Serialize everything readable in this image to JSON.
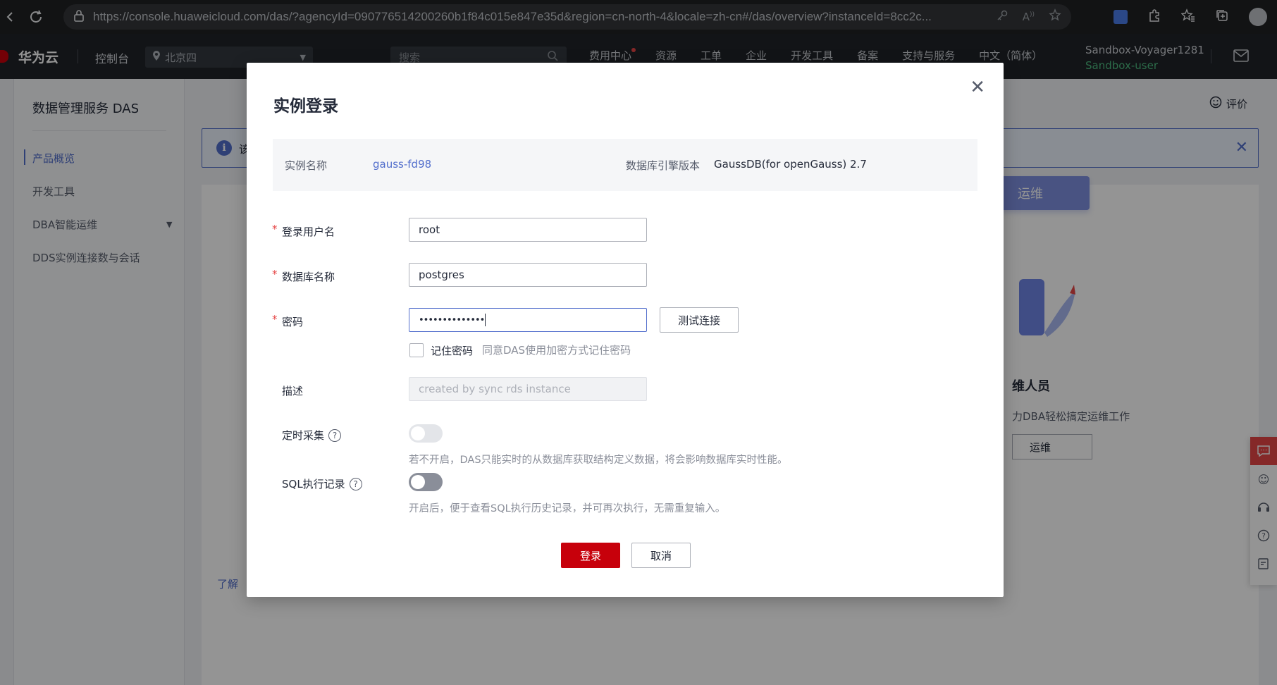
{
  "browser": {
    "url": "https://console.huaweicloud.com/das/?agencyId=090776514200260b1f84c015e847e35d&region=cn-north-4&locale=zh-cn#/das/overview?instanceId=8cc2c..."
  },
  "topnav": {
    "brand": "华为云",
    "console": "控制台",
    "region": "北京四",
    "search_placeholder": "搜索",
    "items": [
      "费用中心",
      "资源",
      "工单",
      "企业",
      "开发工具",
      "备案",
      "支持与服务",
      "中文（简体）"
    ],
    "user_name": "Sandbox-Voyager1281",
    "user_id": "Sandbox-user"
  },
  "sidebar": {
    "title": "数据管理服务 DAS",
    "items": [
      "产品概览",
      "开发工具",
      "DBA智能运维",
      "DDS实例连接数与会话"
    ]
  },
  "background": {
    "rate_label": "评价",
    "notice_text": "该",
    "tab_chip": "运维",
    "card_title": "维人员",
    "card_desc": "力DBA轻松搞定运维工作",
    "card_button": "运维",
    "learn_link": "了解"
  },
  "modal": {
    "title": "实例登录",
    "info": {
      "instance_name_label": "实例名称",
      "instance_name": "gauss-fd98",
      "engine_label": "数据库引擎版本",
      "engine_value": "GaussDB(for openGauss) 2.7"
    },
    "form": {
      "username_label": "登录用户名",
      "username_value": "root",
      "dbname_label": "数据库名称",
      "dbname_value": "postgres",
      "password_label": "密码",
      "password_value": "••••••••••••••",
      "test_button": "测试连接",
      "remember_label": "记住密码",
      "remember_hint": "同意DAS使用加密方式记住密码",
      "remember_checked": false,
      "desc_label": "描述",
      "desc_placeholder": "created by sync rds instance",
      "timed_label": "定时采集",
      "timed_hint": "若不开启，DAS只能实时的从数据库获取结构定义数据，将会影响数据库实时性能。",
      "timed_enabled": false,
      "sql_label": "SQL执行记录",
      "sql_hint": "开启后，便于查看SQL执行历史记录，并可再次执行，无需重复输入。",
      "sql_enabled": false
    },
    "login_button": "登录",
    "cancel_button": "取消"
  },
  "colors": {
    "primary": "#c7000b",
    "link": "#526ecc",
    "nav_bg": "#1f2329",
    "user_id": "#4cb97e"
  }
}
